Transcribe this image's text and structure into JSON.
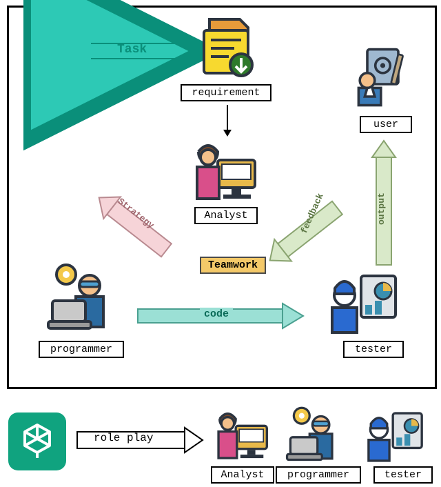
{
  "roles": {
    "user": "user",
    "requirement": "requirement",
    "analyst": "Analyst",
    "programmer": "programmer",
    "tester": "tester"
  },
  "edges": {
    "task": "Task",
    "strategy": "Strategy",
    "teamwork": "Teamwork",
    "code": "code",
    "feedback": "feedback",
    "output": "output",
    "role_play": "role play"
  },
  "legend": {
    "analyst": "Analyst",
    "programmer": "programmer",
    "tester": "tester"
  },
  "colors": {
    "task_arrow": "#2dc9b5",
    "strategy_arrow": "#f6d4d8",
    "feedback_arrow": "#d9e9c9",
    "output_arrow": "#d9e9c9",
    "code_arrow": "#9be0d5",
    "roleplay_arrow": "#ffffff",
    "teamwork_bg": "#f4c969",
    "openai": "#10a37f"
  }
}
